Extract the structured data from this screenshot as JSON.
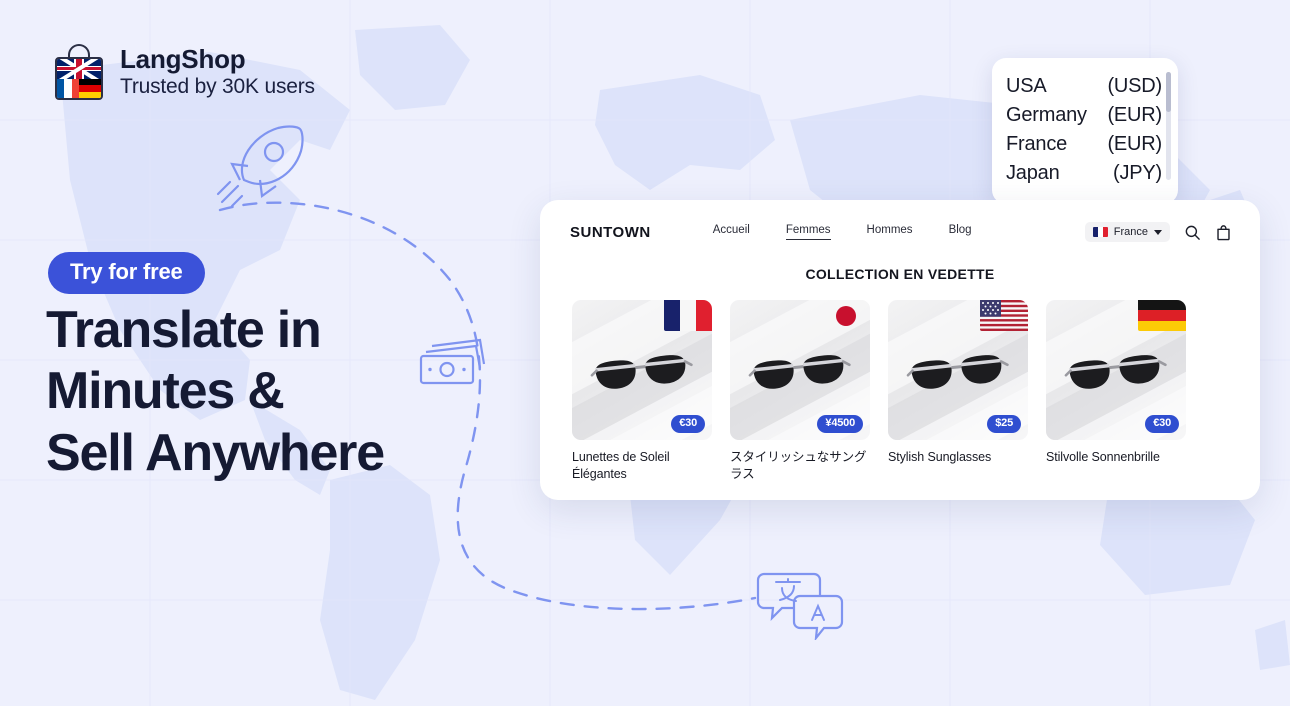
{
  "brand": {
    "logo_icon": "shopping-bag-flags-icon",
    "name": "LangShop",
    "tagline": "Trusted by 30K users",
    "flags": [
      "uk-flag",
      "france-flag",
      "germany-flag"
    ]
  },
  "hero": {
    "cta_label": "Try for free",
    "headline_lines": [
      "Translate in",
      "Minutes &",
      "Sell Anywhere"
    ]
  },
  "decor": {
    "rocket_icon": "rocket-icon",
    "money_icon": "banknotes-icon",
    "translate_icon": "translate-speech-bubbles-icon",
    "path_icon": "dashed-route-icon",
    "map_icon": "world-map-background"
  },
  "currency_panel": {
    "rows": [
      {
        "country": "USA",
        "currency": "(USD)"
      },
      {
        "country": "Germany",
        "currency": "(EUR)"
      },
      {
        "country": "France",
        "currency": "(EUR)"
      },
      {
        "country": "Japan",
        "currency": "(JPY)"
      }
    ],
    "scrollbar": "vertical-scrollbar"
  },
  "storefront": {
    "brand": "SUNTOWN",
    "nav": [
      {
        "label": "Accueil",
        "active": false
      },
      {
        "label": "Femmes",
        "active": true
      },
      {
        "label": "Hommes",
        "active": false
      },
      {
        "label": "Blog",
        "active": false
      }
    ],
    "country_selector": {
      "flag": "france-flag",
      "label": "France",
      "caret": "chevron-down-icon"
    },
    "tools": [
      {
        "name": "search-icon"
      },
      {
        "name": "shopping-bag-icon"
      }
    ],
    "collection_title": "COLLECTION EN VEDETTE",
    "products": [
      {
        "title": "Lunettes de Soleil Élégantes",
        "price": "€30",
        "flag": "france-flag"
      },
      {
        "title": "スタイリッシュなサングラス",
        "price": "¥4500",
        "flag": "japan-flag"
      },
      {
        "title": "Stylish Sunglasses",
        "price": "$25",
        "flag": "usa-flag"
      },
      {
        "title": "Stilvolle Sonnenbrille",
        "price": "€30",
        "flag": "germany-flag"
      }
    ]
  },
  "colors": {
    "background": "#eef0fd",
    "map_land": "#dde3fa",
    "accent_blue": "#3b52d9",
    "price_blue": "#2f4ed0",
    "deco_stroke": "#7f94f0",
    "headline": "#151a33",
    "card_white": "#ffffff"
  }
}
